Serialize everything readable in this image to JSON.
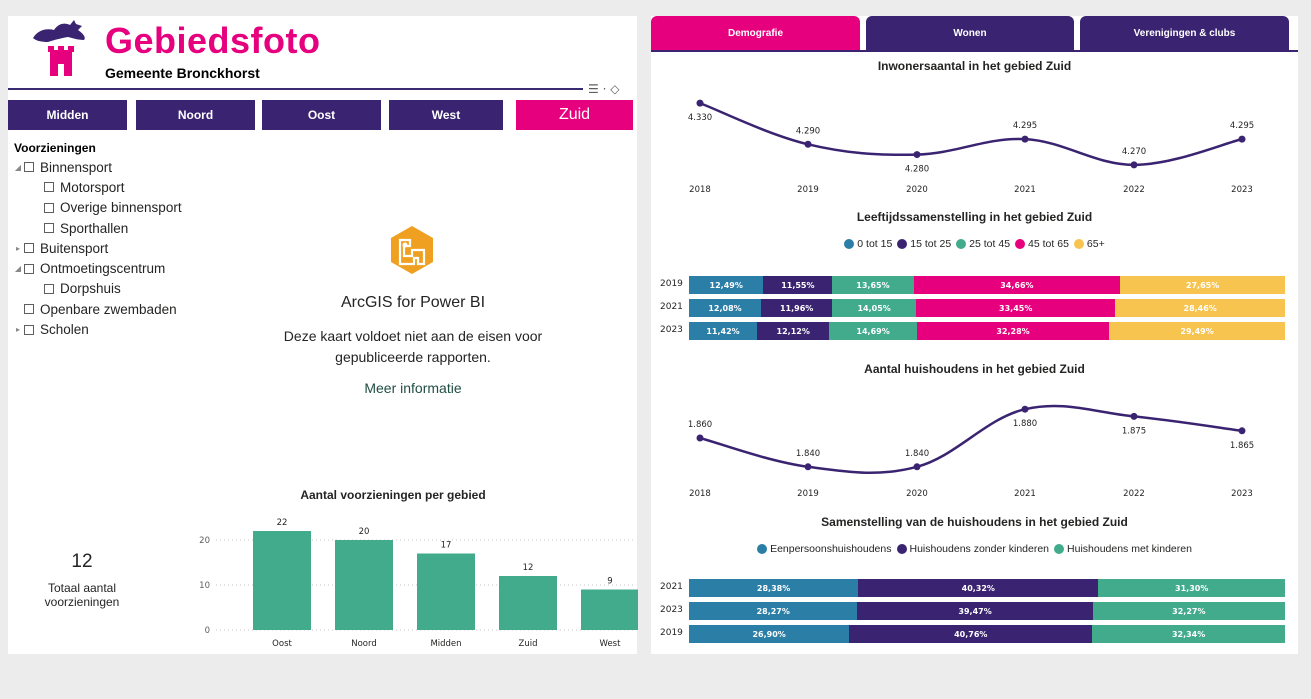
{
  "header": {
    "title": "Gebiedsfoto",
    "subtitle": "Gemeente Bronckhorst"
  },
  "area_buttons": [
    {
      "label": "Midden",
      "selected": false
    },
    {
      "label": "Noord",
      "selected": false
    },
    {
      "label": "Oost",
      "selected": false
    },
    {
      "label": "West",
      "selected": false
    },
    {
      "label": "Zuid",
      "selected": true
    }
  ],
  "slicer": {
    "title": "Voorzieningen",
    "items": [
      {
        "label": "Binnensport",
        "level": 0,
        "expand": "expanded"
      },
      {
        "label": "Motorsport",
        "level": 1,
        "expand": "none"
      },
      {
        "label": "Overige binnensport",
        "level": 1,
        "expand": "none"
      },
      {
        "label": "Sporthallen",
        "level": 1,
        "expand": "none"
      },
      {
        "label": "Buitensport",
        "level": 0,
        "expand": "collapsed"
      },
      {
        "label": "Ontmoetingscentrum",
        "level": 0,
        "expand": "expanded"
      },
      {
        "label": "Dorpshuis",
        "level": 1,
        "expand": "none"
      },
      {
        "label": "Openbare zwembaden",
        "level": 0,
        "expand": "none"
      },
      {
        "label": "Scholen",
        "level": 0,
        "expand": "collapsed"
      }
    ]
  },
  "arcgis": {
    "title": "ArcGIS for Power BI",
    "message_line1": "Deze kaart voldoet niet aan de eisen voor",
    "message_line2": "gepubliceerde rapporten.",
    "link": "Meer informatie"
  },
  "kpi": {
    "value": "12",
    "label_line1": "Totaal aantal",
    "label_line2": "voorzieningen"
  },
  "tabs": [
    {
      "label": "Demografie",
      "selected": true
    },
    {
      "label": "Wonen",
      "selected": false
    },
    {
      "label": "Verenigingen & clubs",
      "selected": false
    }
  ],
  "colors": {
    "brand_pink": "#e6007e",
    "brand_purple": "#3a2471",
    "teal": "#41ab8b",
    "blue": "#2b7ea6",
    "yellow": "#f7c450"
  },
  "chart_data": [
    {
      "id": "voorzieningen",
      "type": "bar",
      "title": "Aantal voorzieningen per gebied",
      "categories": [
        "Oost",
        "Noord",
        "Midden",
        "Zuid",
        "West"
      ],
      "values": [
        22,
        20,
        17,
        12,
        9
      ],
      "yticks": [
        0,
        10,
        20
      ],
      "ylim": [
        0,
        24
      ],
      "color": "#41ab8b",
      "grid": true
    },
    {
      "id": "inwoners",
      "type": "line",
      "title": "Inwonersaantal in het gebied Zuid",
      "x": [
        "2018",
        "2019",
        "2020",
        "2021",
        "2022",
        "2023"
      ],
      "values": [
        4330,
        4290,
        4280,
        4295,
        4270,
        4295
      ],
      "labels": [
        "4.330",
        "4.290",
        "4.280",
        "4.295",
        "4.270",
        "4.295"
      ],
      "ylim": [
        4265,
        4335
      ],
      "color": "#3a2471"
    },
    {
      "id": "leeftijd",
      "type": "bar",
      "stacked": true,
      "orientation": "horizontal",
      "title": "Leeftijdssamenstelling in het gebied Zuid",
      "categories": [
        "2019",
        "2021",
        "2023"
      ],
      "series": [
        {
          "name": "0 tot 15",
          "color": "#2b7ea6",
          "values": [
            12.49,
            12.08,
            11.42
          ],
          "labels": [
            "12,49%",
            "12,08%",
            "11,42%"
          ]
        },
        {
          "name": "15 tot 25",
          "color": "#3a2471",
          "values": [
            11.55,
            11.96,
            12.12
          ],
          "labels": [
            "11,55%",
            "11,96%",
            "12,12%"
          ]
        },
        {
          "name": "25 tot 45",
          "color": "#41ab8b",
          "values": [
            13.65,
            14.05,
            14.69
          ],
          "labels": [
            "13,65%",
            "14,05%",
            "14,69%"
          ]
        },
        {
          "name": "45 tot 65",
          "color": "#e6007e",
          "values": [
            34.66,
            33.45,
            32.28
          ],
          "labels": [
            "34,66%",
            "33,45%",
            "32,28%"
          ]
        },
        {
          "name": "65+",
          "color": "#f7c450",
          "values": [
            27.65,
            28.46,
            29.49
          ],
          "labels": [
            "27,65%",
            "28,46%",
            "29,49%"
          ]
        }
      ]
    },
    {
      "id": "huishoudens",
      "type": "line",
      "title": "Aantal huishoudens in het gebied Zuid",
      "x": [
        "2018",
        "2019",
        "2020",
        "2021",
        "2022",
        "2023"
      ],
      "values": [
        1860,
        1840,
        1840,
        1880,
        1875,
        1865
      ],
      "labels": [
        "1.860",
        "1.840",
        "1.840",
        "1.880",
        "1.875",
        "1.865"
      ],
      "ylim": [
        1835,
        1885
      ],
      "color": "#3a2471"
    },
    {
      "id": "samenstelling",
      "type": "bar",
      "stacked": true,
      "orientation": "horizontal",
      "title": "Samenstelling van de huishoudens in het gebied Zuid",
      "categories": [
        "2021",
        "2023",
        "2019"
      ],
      "series": [
        {
          "name": "Eenpersoonshuishoudens",
          "color": "#2b7ea6",
          "values": [
            28.38,
            28.27,
            26.9
          ],
          "labels": [
            "28,38%",
            "28,27%",
            "26,90%"
          ]
        },
        {
          "name": "Huishoudens zonder kinderen",
          "color": "#3a2471",
          "values": [
            40.32,
            39.47,
            40.76
          ],
          "labels": [
            "40,32%",
            "39,47%",
            "40,76%"
          ]
        },
        {
          "name": "Huishoudens met kinderen",
          "color": "#41ab8b",
          "values": [
            31.3,
            32.27,
            32.34
          ],
          "labels": [
            "31,30%",
            "32,27%",
            "32,34%"
          ]
        }
      ]
    }
  ]
}
